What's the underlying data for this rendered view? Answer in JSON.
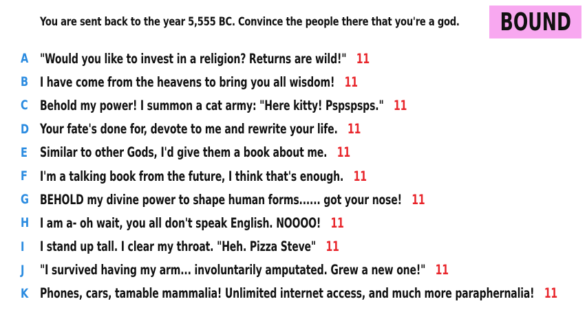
{
  "prompt": "You are sent back to the year 5,555 BC. Convince the people there that you're a god.",
  "badge": "BOUND",
  "answers": [
    {
      "letter": "A",
      "text": "\"Would you like to invest in a religion? Returns are wild!\"",
      "score": "11"
    },
    {
      "letter": "B",
      "text": "I have come from the heavens to bring you all wisdom!",
      "score": "11"
    },
    {
      "letter": "C",
      "text": "Behold my power! I summon a cat army: \"Here kitty! Pspspsps.\"",
      "score": "11"
    },
    {
      "letter": "D",
      "text": "Your fate's done for, devote to me and rewrite your life.",
      "score": "11"
    },
    {
      "letter": "E",
      "text": "Similar to other Gods, I'd give them a book about me.",
      "score": "11"
    },
    {
      "letter": "F",
      "text": "I'm a talking book from the future, I think that's enough.",
      "score": "11"
    },
    {
      "letter": "G",
      "text": "BEHOLD my divine power to shape human forms...... got your nose!",
      "score": "11"
    },
    {
      "letter": "H",
      "text": "I am a- oh wait, you all don't speak English. NOOOO!",
      "score": "11"
    },
    {
      "letter": "I",
      "text": "I stand up tall. I clear my throat. \"Heh. Pizza Steve\"",
      "score": "11"
    },
    {
      "letter": "J",
      "text": "\"I survived having my arm... involuntarily amputated. Grew a new one!\"",
      "score": "11"
    },
    {
      "letter": "K",
      "text": "Phones, cars, tamable mammalia! Unlimited internet access, and much more paraphernalia!",
      "score": "11"
    }
  ]
}
